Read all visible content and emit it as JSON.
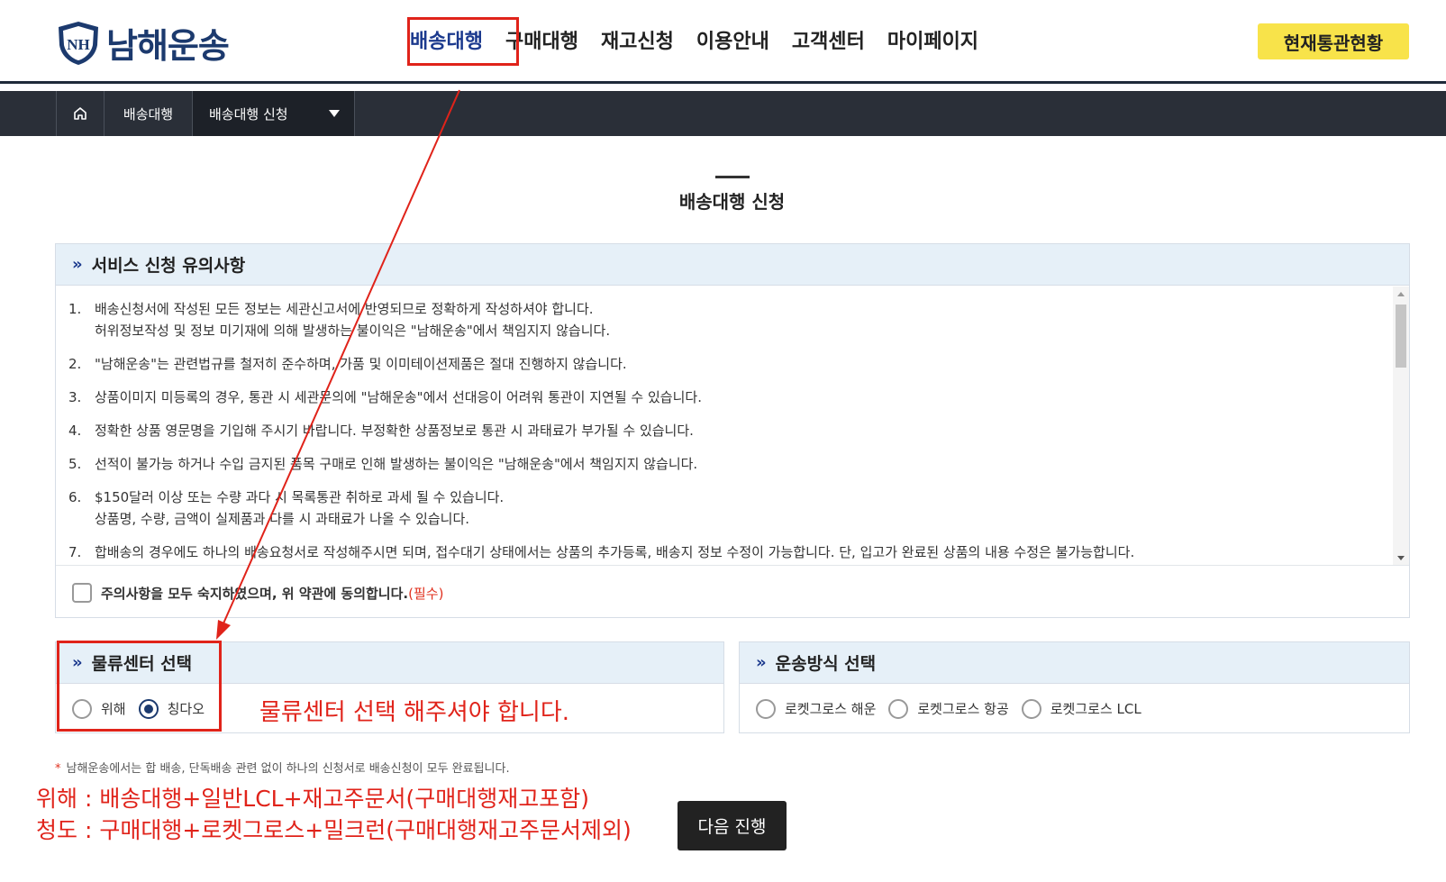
{
  "brand": {
    "name": "남해운송",
    "emblem": "NH"
  },
  "nav": {
    "items": [
      "배송대행",
      "구매대행",
      "재고신청",
      "이용안내",
      "고객센터",
      "마이페이지"
    ],
    "active_index": 0
  },
  "customs_button": "현재통관현황",
  "breadcrumb": {
    "home_icon": "home-icon",
    "level1": "배송대행",
    "level2": "배송대행 신청"
  },
  "page_title": "배송대행 신청",
  "notice": {
    "heading": "서비스 신청 유의사항",
    "items": [
      {
        "num": "1.",
        "lines": [
          "배송신청서에 작성된 모든 정보는 세관신고서에 반영되므로 정확하게 작성하셔야 합니다.",
          "허위정보작성 및 정보 미기재에 의해 발생하는 불이익은 \"남해운송\"에서 책임지지 않습니다."
        ]
      },
      {
        "num": "2.",
        "lines": [
          "\"남해운송\"는 관련법규를 철저히 준수하며, 가품 및 이미테이션제품은 절대 진행하지 않습니다."
        ]
      },
      {
        "num": "3.",
        "lines": [
          "상품이미지 미등록의 경우, 통관 시 세관문의에 \"남해운송\"에서 선대응이 어려워 통관이 지연될 수 있습니다."
        ]
      },
      {
        "num": "4.",
        "lines": [
          "정확한 상품 영문명을 기입해 주시기 바랍니다. 부정확한 상품정보로 통관 시 과태료가 부가될 수 있습니다."
        ]
      },
      {
        "num": "5.",
        "lines": [
          "선적이 불가능 하거나 수입 금지된 품목 구매로 인해 발생하는 불이익은 \"남해운송\"에서 책임지지 않습니다."
        ]
      },
      {
        "num": "6.",
        "lines": [
          "$150달러 이상 또는 수량 과다 시 목록통관 취하로 과세 될 수 있습니다.",
          "상품명, 수량, 금액이 실제품과 다를 시 과태료가 나올 수 있습니다."
        ]
      },
      {
        "num": "7.",
        "lines": [
          "합배송의 경우에도 하나의 배송요청서로 작성해주시면 되며, 접수대기 상태에서는 상품의 추가등록, 배송지 정보 수정이 가능합니다. 단, 입고가 완료된 상품의 내용 수정은 불가능합니다."
        ]
      }
    ],
    "agree_label": "주의사항을 모두 숙지하였으며, 위 약관에 동의합니다.",
    "agree_required": "(필수)",
    "agree_checked": false
  },
  "center": {
    "heading": "물류센터 선택",
    "options": [
      "위해",
      "칭다오"
    ],
    "selected_index": 1
  },
  "transport": {
    "heading": "운송방식 선택",
    "options": [
      "로켓그로스 해운",
      "로켓그로스 항공",
      "로켓그로스 LCL"
    ],
    "selected_index": -1
  },
  "annotation": "물류센터 선택 해주셔야 합니다.",
  "footnote": {
    "star": "*",
    "text": "남해운송에서는 합 배송, 단독배송 관련 없이 하나의 신청서로 배송신청이 모두 완료됩니다."
  },
  "red_notes": [
    "위해 : 배송대행+일반LCL+재고주문서(구매대행재고포함)",
    "청도 : 구매대행+로켓그로스+밀크런(구매대행재고주문서제외)"
  ],
  "next_button": "다음 진행",
  "colors": {
    "brand": "#1c3a6e",
    "accent_yellow": "#f8e34a",
    "annotation_red": "#e0231a",
    "dark_bar": "#2a2f38"
  }
}
